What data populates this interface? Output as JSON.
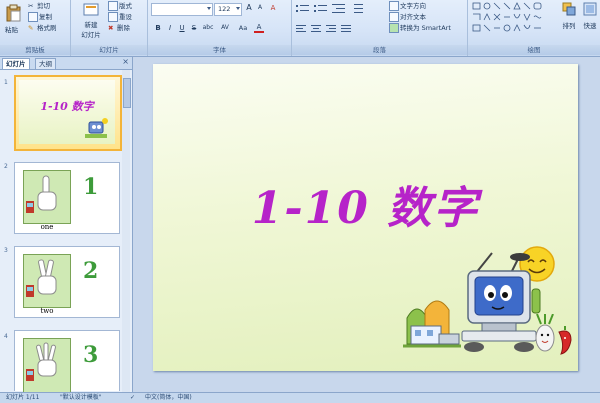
{
  "ribbon": {
    "clipboard": {
      "paste": "粘贴",
      "cut": "剪切",
      "copy": "复制",
      "format_painter": "格式刷",
      "label": "剪贴板"
    },
    "slides": {
      "new_slide": "新建",
      "new_slide_2": "幻灯片",
      "layout": "版式",
      "reset": "重设",
      "delete": "删除",
      "label": "幻灯片"
    },
    "font": {
      "size": "122",
      "grow": "A",
      "shrink": "A",
      "clear": "A",
      "bold": "B",
      "italic": "I",
      "underline": "U",
      "strike": "S",
      "shadow": "abc",
      "spacing": "AV",
      "case": "Aa",
      "color": "A",
      "label": "字体"
    },
    "paragraph": {
      "text_direction": "文字方向",
      "align_text": "对齐文本",
      "smartart": "转换为 SmartArt",
      "label": "段落"
    },
    "drawing": {
      "arrange": "排列",
      "quick_styles": "快速",
      "label": "绘图"
    }
  },
  "panel": {
    "tabs": [
      "幻灯片",
      "大纲"
    ],
    "thumbnails": [
      {
        "num": "1",
        "text": "1-10 数字"
      },
      {
        "num": "2",
        "text": "one",
        "digit": "1"
      },
      {
        "num": "3",
        "text": "two",
        "digit": "2"
      },
      {
        "num": "4",
        "text": "",
        "digit": "3"
      }
    ]
  },
  "slide": {
    "title": "1-10 数字"
  },
  "status": {
    "slide_info": "幻灯片 1/11",
    "theme": "\"默认设计模板\"",
    "language": "中文(简体，中国)"
  },
  "colors": {
    "title": "#b623c9",
    "selected_border": "#f3b43a"
  }
}
